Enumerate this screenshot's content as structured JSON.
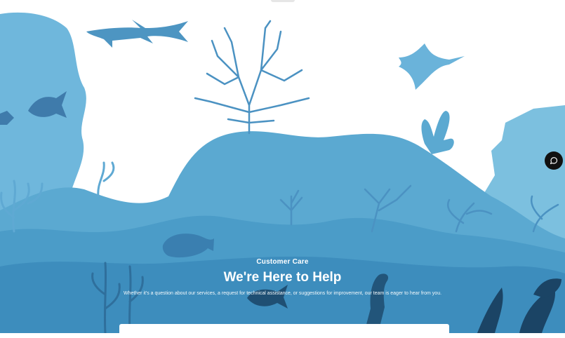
{
  "hero": {
    "eyebrow": "Customer Care",
    "title": "We're Here to Help",
    "subtitle": "Whether it's a question about our services, a request for technical assistance, or suggestions for improvement, our team is eager to hear from you."
  },
  "chat_widget": {
    "icon": "chat-bubble-icon"
  },
  "colors": {
    "water_light": "#7cc0df",
    "water_mid": "#5ba9d1",
    "water_deep": "#3d8dbd",
    "silhouette": "#3f82b0",
    "deep_silhouette": "#1f4f73",
    "chat_button": "#111111"
  }
}
